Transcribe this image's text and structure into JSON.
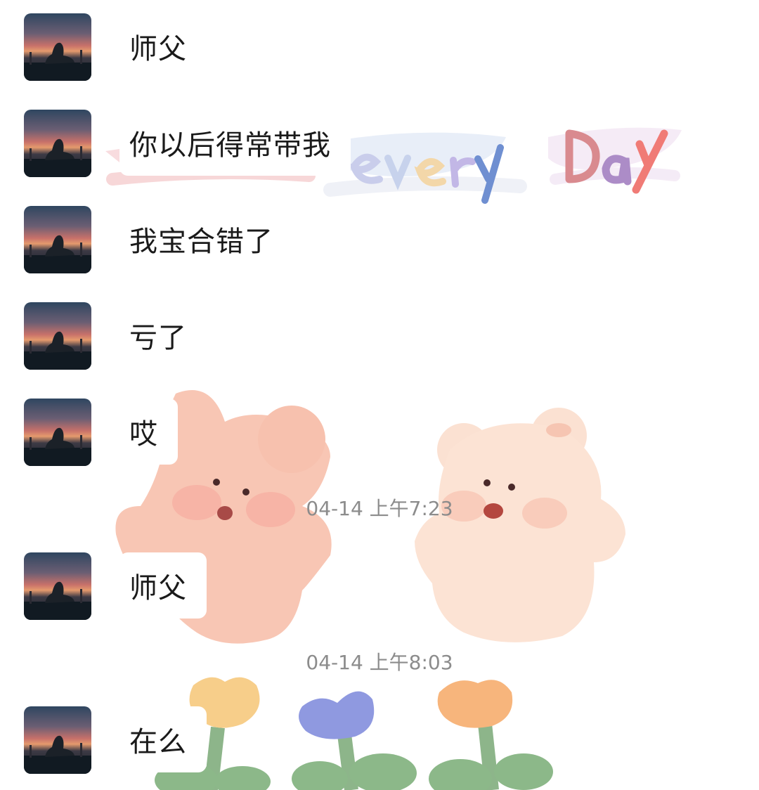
{
  "messages": [
    {
      "text": "师父"
    },
    {
      "text": "你以后得常带我"
    },
    {
      "text": "我宝合错了"
    },
    {
      "text": "亏了"
    },
    {
      "text": "哎"
    },
    {
      "text": "师父"
    },
    {
      "text": "在么"
    }
  ],
  "timestamps": [
    {
      "text": "04-14 上午7:23"
    },
    {
      "text": "04-14 上午8:03"
    }
  ],
  "wallpaper": {
    "lettering": "Happy every Day"
  }
}
